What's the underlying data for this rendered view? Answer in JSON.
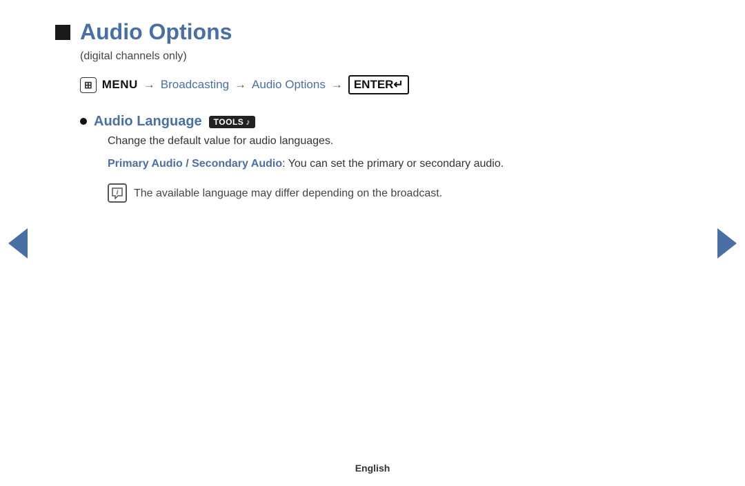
{
  "page": {
    "title": "Audio Options",
    "subtitle": "(digital channels only)",
    "breadcrumb": {
      "menu_label": "MENU",
      "arrow": "→",
      "broadcasting": "Broadcasting",
      "audio_options": "Audio Options",
      "enter_label": "ENTER"
    },
    "section": {
      "audio_language_label": "Audio Language",
      "tools_badge": "TOOLS",
      "change_default_text": "Change the default value for audio languages.",
      "primary_secondary_label": "Primary Audio / Secondary Audio",
      "primary_secondary_text": ": You can set the primary or secondary audio.",
      "note_text": "The available language may differ depending on the broadcast."
    }
  },
  "nav": {
    "left_arrow_label": "previous",
    "right_arrow_label": "next"
  },
  "footer": {
    "language": "English"
  }
}
